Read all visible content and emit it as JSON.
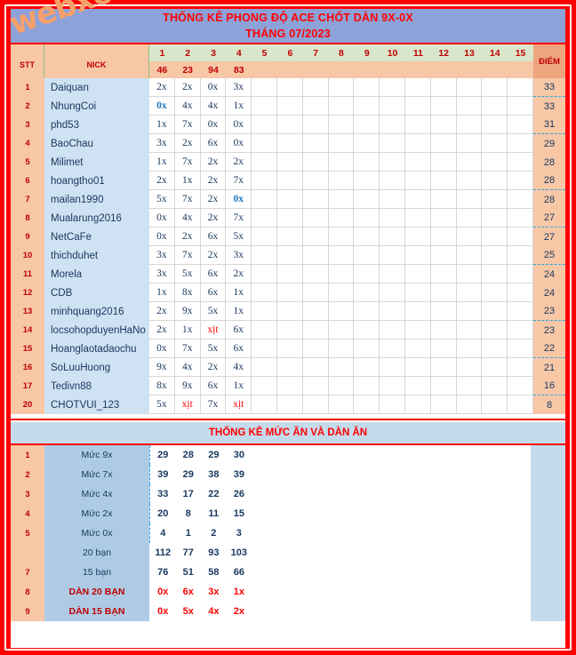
{
  "watermark": "webxoso.net",
  "header": {
    "title_line1": "THỐNG KÊ PHONG ĐỘ ACE CHỐT DÀN 9X-0X",
    "title_line2": "THÁNG 07/2023",
    "col_stt": "STT",
    "col_nick": "NICK",
    "col_diem": "ĐIỂM",
    "day_numbers": [
      "1",
      "2",
      "3",
      "4",
      "5",
      "6",
      "7",
      "8",
      "9",
      "10",
      "11",
      "12",
      "13",
      "14",
      "15"
    ],
    "day_values": [
      "46",
      "23",
      "94",
      "83",
      "",
      "",
      "",
      "",
      "",
      "",
      "",
      "",
      "",
      "",
      ""
    ]
  },
  "colors": {
    "frame": "#ff0000",
    "title_bg": "#8da2d8",
    "title_text": "#ff0000",
    "header_num_bg": "#d9e6cb",
    "header_val_bg": "#f7c7a6",
    "stt_bg": "#f7c7a6",
    "nick_bg": "#cfe2f3",
    "diem_bg": "#f7c7a6",
    "section2_bg": "#c5dbeb",
    "label_bg": "#aecbe5",
    "blue_value": "#1f7ac0",
    "red_value": "#ff0000",
    "dash_line": "#2aa8e0"
  },
  "rows": [
    {
      "stt": "1",
      "nick": "Daiquan",
      "vals": [
        "2x",
        "2x",
        "0x",
        "3x",
        "",
        "",
        "",
        "",
        "",
        "",
        "",
        "",
        "",
        "",
        ""
      ],
      "styles": [
        "",
        "",
        "",
        "",
        "",
        "",
        "",
        "",
        "",
        "",
        "",
        "",
        "",
        "",
        ""
      ],
      "diem": "33",
      "dash": true
    },
    {
      "stt": "2",
      "nick": "NhungCoi",
      "vals": [
        "0x",
        "4x",
        "4x",
        "1x",
        "",
        "",
        "",
        "",
        "",
        "",
        "",
        "",
        "",
        "",
        ""
      ],
      "styles": [
        "blue-v",
        "",
        "",
        "",
        "",
        "",
        "",
        "",
        "",
        "",
        "",
        "",
        "",
        "",
        ""
      ],
      "diem": "33",
      "dash": false
    },
    {
      "stt": "3",
      "nick": "phd53",
      "vals": [
        "1x",
        "7x",
        "0x",
        "0x",
        "",
        "",
        "",
        "",
        "",
        "",
        "",
        "",
        "",
        "",
        ""
      ],
      "styles": [
        "",
        "",
        "",
        "",
        "",
        "",
        "",
        "",
        "",
        "",
        "",
        "",
        "",
        "",
        ""
      ],
      "diem": "31",
      "dash": true
    },
    {
      "stt": "4",
      "nick": "BaoChau",
      "vals": [
        "3x",
        "2x",
        "6x",
        "0x",
        "",
        "",
        "",
        "",
        "",
        "",
        "",
        "",
        "",
        "",
        ""
      ],
      "styles": [
        "",
        "",
        "",
        "",
        "",
        "",
        "",
        "",
        "",
        "",
        "",
        "",
        "",
        "",
        ""
      ],
      "diem": "29",
      "dash": false
    },
    {
      "stt": "5",
      "nick": "Milimet",
      "vals": [
        "1x",
        "7x",
        "2x",
        "2x",
        "",
        "",
        "",
        "",
        "",
        "",
        "",
        "",
        "",
        "",
        ""
      ],
      "styles": [
        "",
        "",
        "",
        "",
        "",
        "",
        "",
        "",
        "",
        "",
        "",
        "",
        "",
        "",
        ""
      ],
      "diem": "28",
      "dash": false
    },
    {
      "stt": "6",
      "nick": "hoangtho01",
      "vals": [
        "2x",
        "1x",
        "2x",
        "7x",
        "",
        "",
        "",
        "",
        "",
        "",
        "",
        "",
        "",
        "",
        ""
      ],
      "styles": [
        "",
        "",
        "",
        "",
        "",
        "",
        "",
        "",
        "",
        "",
        "",
        "",
        "",
        "",
        ""
      ],
      "diem": "28",
      "dash": true
    },
    {
      "stt": "7",
      "nick": "mailan1990",
      "vals": [
        "5x",
        "7x",
        "2x",
        "0x",
        "",
        "",
        "",
        "",
        "",
        "",
        "",
        "",
        "",
        "",
        ""
      ],
      "styles": [
        "",
        "",
        "",
        "blue-v",
        "",
        "",
        "",
        "",
        "",
        "",
        "",
        "",
        "",
        "",
        ""
      ],
      "diem": "28",
      "dash": false
    },
    {
      "stt": "8",
      "nick": "Mualarung2016",
      "vals": [
        "0x",
        "4x",
        "2x",
        "7x",
        "",
        "",
        "",
        "",
        "",
        "",
        "",
        "",
        "",
        "",
        ""
      ],
      "styles": [
        "",
        "",
        "",
        "",
        "",
        "",
        "",
        "",
        "",
        "",
        "",
        "",
        "",
        "",
        ""
      ],
      "diem": "27",
      "dash": true
    },
    {
      "stt": "9",
      "nick": "NetCaFe",
      "vals": [
        "0x",
        "2x",
        "6x",
        "5x",
        "",
        "",
        "",
        "",
        "",
        "",
        "",
        "",
        "",
        "",
        ""
      ],
      "styles": [
        "",
        "",
        "",
        "",
        "",
        "",
        "",
        "",
        "",
        "",
        "",
        "",
        "",
        "",
        ""
      ],
      "diem": "27",
      "dash": false
    },
    {
      "stt": "10",
      "nick": "thichduhet",
      "vals": [
        "3x",
        "7x",
        "2x",
        "3x",
        "",
        "",
        "",
        "",
        "",
        "",
        "",
        "",
        "",
        "",
        ""
      ],
      "styles": [
        "",
        "",
        "",
        "",
        "",
        "",
        "",
        "",
        "",
        "",
        "",
        "",
        "",
        "",
        ""
      ],
      "diem": "25",
      "dash": true
    },
    {
      "stt": "11",
      "nick": "Morela",
      "vals": [
        "3x",
        "5x",
        "6x",
        "2x",
        "",
        "",
        "",
        "",
        "",
        "",
        "",
        "",
        "",
        "",
        ""
      ],
      "styles": [
        "",
        "",
        "",
        "",
        "",
        "",
        "",
        "",
        "",
        "",
        "",
        "",
        "",
        "",
        ""
      ],
      "diem": "24",
      "dash": false
    },
    {
      "stt": "12",
      "nick": "CDB",
      "vals": [
        "1x",
        "8x",
        "6x",
        "1x",
        "",
        "",
        "",
        "",
        "",
        "",
        "",
        "",
        "",
        "",
        ""
      ],
      "styles": [
        "",
        "",
        "",
        "",
        "",
        "",
        "",
        "",
        "",
        "",
        "",
        "",
        "",
        "",
        ""
      ],
      "diem": "24",
      "dash": false
    },
    {
      "stt": "13",
      "nick": "minhquang2016",
      "vals": [
        "2x",
        "9x",
        "5x",
        "1x",
        "",
        "",
        "",
        "",
        "",
        "",
        "",
        "",
        "",
        "",
        ""
      ],
      "styles": [
        "",
        "",
        "",
        "",
        "",
        "",
        "",
        "",
        "",
        "",
        "",
        "",
        "",
        "",
        ""
      ],
      "diem": "23",
      "dash": true
    },
    {
      "stt": "14",
      "nick": "locsohopduyenHaNo",
      "vals": [
        "2x",
        "1x",
        "xịt",
        "6x",
        "",
        "",
        "",
        "",
        "",
        "",
        "",
        "",
        "",
        "",
        ""
      ],
      "styles": [
        "",
        "",
        "xit",
        "",
        "",
        "",
        "",
        "",
        "",
        "",
        "",
        "",
        "",
        "",
        ""
      ],
      "diem": "23",
      "dash": false
    },
    {
      "stt": "15",
      "nick": "Hoanglaotadaochu",
      "vals": [
        "0x",
        "7x",
        "5x",
        "6x",
        "",
        "",
        "",
        "",
        "",
        "",
        "",
        "",
        "",
        "",
        ""
      ],
      "styles": [
        "",
        "",
        "",
        "",
        "",
        "",
        "",
        "",
        "",
        "",
        "",
        "",
        "",
        "",
        ""
      ],
      "diem": "22",
      "dash": true
    },
    {
      "stt": "16",
      "nick": "SoLuuHuong",
      "vals": [
        "9x",
        "4x",
        "2x",
        "4x",
        "",
        "",
        "",
        "",
        "",
        "",
        "",
        "",
        "",
        "",
        ""
      ],
      "styles": [
        "",
        "",
        "",
        "",
        "",
        "",
        "",
        "",
        "",
        "",
        "",
        "",
        "",
        "",
        ""
      ],
      "diem": "21",
      "dash": false
    },
    {
      "stt": "17",
      "nick": "Tedivn88",
      "vals": [
        "8x",
        "9x",
        "6x",
        "1x",
        "",
        "",
        "",
        "",
        "",
        "",
        "",
        "",
        "",
        "",
        ""
      ],
      "styles": [
        "",
        "",
        "",
        "",
        "",
        "",
        "",
        "",
        "",
        "",
        "",
        "",
        "",
        "",
        ""
      ],
      "diem": "16",
      "dash": true
    },
    {
      "stt": "20",
      "nick": "CHOTVUI_123",
      "vals": [
        "5x",
        "xịt",
        "7x",
        "xịt",
        "",
        "",
        "",
        "",
        "",
        "",
        "",
        "",
        "",
        "",
        ""
      ],
      "styles": [
        "",
        "xit",
        "",
        "xit",
        "",
        "",
        "",
        "",
        "",
        "",
        "",
        "",
        "",
        "",
        ""
      ],
      "diem": "8",
      "dash": false
    }
  ],
  "section2": {
    "title": "THỐNG KÊ MỨC ĂN VÀ DÀN ĂN",
    "rows": [
      {
        "stt": "1",
        "label": "Mức 9x",
        "vals": [
          "29",
          "28",
          "29",
          "30",
          "",
          "",
          "",
          "",
          "",
          "",
          "",
          "",
          "",
          "",
          ""
        ],
        "red": false,
        "sep": "",
        "dashgrid": true
      },
      {
        "stt": "2",
        "label": "Mức 7x",
        "vals": [
          "39",
          "29",
          "38",
          "39",
          "",
          "",
          "",
          "",
          "",
          "",
          "",
          "",
          "",
          "",
          ""
        ],
        "red": false,
        "sep": "",
        "dashgrid": true
      },
      {
        "stt": "3",
        "label": "Mức 4x",
        "vals": [
          "33",
          "17",
          "22",
          "26",
          "",
          "",
          "",
          "",
          "",
          "",
          "",
          "",
          "",
          "",
          ""
        ],
        "red": false,
        "sep": "sep-dash",
        "dashgrid": true
      },
      {
        "stt": "4",
        "label": "Mức 2x",
        "vals": [
          "20",
          "8",
          "11",
          "15",
          "",
          "",
          "",
          "",
          "",
          "",
          "",
          "",
          "",
          "",
          ""
        ],
        "red": false,
        "sep": "",
        "dashgrid": true
      },
      {
        "stt": "5",
        "label": "Mức 0x",
        "vals": [
          "4",
          "1",
          "2",
          "3",
          "",
          "",
          "",
          "",
          "",
          "",
          "",
          "",
          "",
          "",
          ""
        ],
        "red": false,
        "sep": "",
        "dashgrid": true
      },
      {
        "stt": "",
        "label": "20 bạn",
        "vals": [
          "112",
          "77",
          "93",
          "103",
          "",
          "",
          "",
          "",
          "",
          "",
          "",
          "",
          "",
          "",
          ""
        ],
        "red": false,
        "sep": "",
        "dashgrid": false
      },
      {
        "stt": "7",
        "label": "15 bạn",
        "vals": [
          "76",
          "51",
          "58",
          "66",
          "",
          "",
          "",
          "",
          "",
          "",
          "",
          "",
          "",
          "",
          ""
        ],
        "red": false,
        "sep": "sep-red",
        "dashgrid": false
      },
      {
        "stt": "8",
        "label": "DÀN 20 BẠN",
        "vals": [
          "0x",
          "6x",
          "3x",
          "1x",
          "",
          "",
          "",
          "",
          "",
          "",
          "",
          "",
          "",
          "",
          ""
        ],
        "red": true,
        "sep": "",
        "dashgrid": false
      },
      {
        "stt": "9",
        "label": "DÀN 15 BẠN",
        "vals": [
          "0x",
          "5x",
          "4x",
          "2x",
          "",
          "",
          "",
          "",
          "",
          "",
          "",
          "",
          "",
          "",
          ""
        ],
        "red": true,
        "sep": "",
        "dashgrid": false
      }
    ]
  }
}
